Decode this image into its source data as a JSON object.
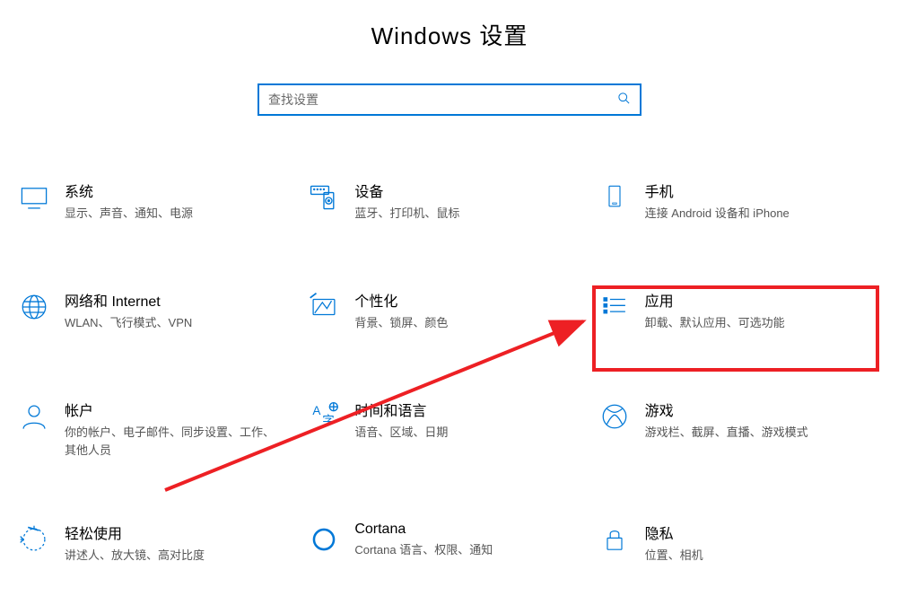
{
  "page": {
    "title": "Windows 设置"
  },
  "search": {
    "placeholder": "查找设置"
  },
  "tiles": {
    "system": {
      "title": "系统",
      "desc": "显示、声音、通知、电源"
    },
    "devices": {
      "title": "设备",
      "desc": "蓝牙、打印机、鼠标"
    },
    "phone": {
      "title": "手机",
      "desc": "连接 Android 设备和 iPhone"
    },
    "network": {
      "title": "网络和 Internet",
      "desc": "WLAN、飞行模式、VPN"
    },
    "personal": {
      "title": "个性化",
      "desc": "背景、锁屏、颜色"
    },
    "apps": {
      "title": "应用",
      "desc": "卸载、默认应用、可选功能"
    },
    "accounts": {
      "title": "帐户",
      "desc": "你的帐户、电子邮件、同步设置、工作、其他人员"
    },
    "time": {
      "title": "时间和语言",
      "desc": "语音、区域、日期"
    },
    "gaming": {
      "title": "游戏",
      "desc": "游戏栏、截屏、直播、游戏模式"
    },
    "ease": {
      "title": "轻松使用",
      "desc": "讲述人、放大镜、高对比度"
    },
    "cortana": {
      "title": "Cortana",
      "desc": "Cortana 语言、权限、通知"
    },
    "privacy": {
      "title": "隐私",
      "desc": "位置、相机"
    }
  },
  "colors": {
    "accent": "#0078d7",
    "highlight": "#ed2024"
  }
}
